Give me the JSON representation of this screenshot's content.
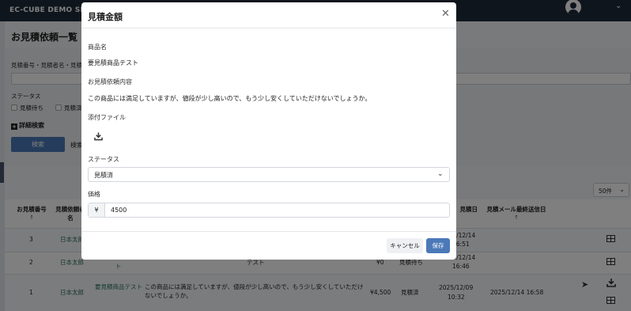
{
  "app": {
    "brand": "EC-CUBE DEMO SHOP"
  },
  "page": {
    "title": "お見積依頼一覧",
    "search": {
      "label": "見積番号・見積者名・見積",
      "status_label": "ステータス",
      "status_options": [
        "見積待ち",
        "見積済"
      ],
      "advanced_label": "詳細検索",
      "button_label": "検索",
      "count_label": "検索"
    },
    "per_page": "50件",
    "table": {
      "headers": {
        "number": "お見積番号",
        "requester": "見積依頼者名",
        "date": "見積日",
        "mail_sent": "見積メール最終送信日"
      },
      "sort_arrow": "↑",
      "rows": [
        {
          "number": "3",
          "requester": "日本太郎",
          "product": "",
          "content": "",
          "price": "",
          "status": "",
          "date": "2025/12/14",
          "time": "16:51",
          "mail_sent": ""
        },
        {
          "number": "2",
          "requester": "日本太郎",
          "product": "ト",
          "content": "テスト",
          "price": "¥0",
          "status": "見積待ち",
          "date": "2025/12/14",
          "time": "16:46",
          "mail_sent": ""
        },
        {
          "number": "1",
          "requester": "日本太郎",
          "product": "要見積商品テスト",
          "content": "この商品には満足していますが、値段が少し高いので、もう少し安くしていただけないでしょうか。",
          "price": "¥4,500",
          "status": "見積済",
          "date": "2025/12/09",
          "time": "10:32",
          "mail_sent": "2025/12/14 16:58"
        }
      ]
    }
  },
  "modal": {
    "title": "見積金額",
    "fields": {
      "product_label": "商品名",
      "product_value": "要見積商品テスト",
      "request_label": "お見積依頼内容",
      "request_value": "この商品には満足していますが、値段が少し高いので、もう少し安くしていただけないでしょうか。",
      "attachment_label": "添付ファイル",
      "status_label": "ステータス",
      "status_value": "見積済",
      "price_label": "価格",
      "currency": "¥",
      "price_value": "4500"
    },
    "buttons": {
      "cancel": "キャンセル",
      "save": "保存"
    }
  },
  "icons": {
    "close": "close-icon",
    "download": "download-icon",
    "chevron": "chevron-down-icon",
    "send": "send-icon",
    "grid": "table-icon",
    "avatar": "user-icon"
  },
  "colors": {
    "topbar": "#1d2a3b",
    "primary": "#4b79b8",
    "link": "#2a6f5e"
  }
}
